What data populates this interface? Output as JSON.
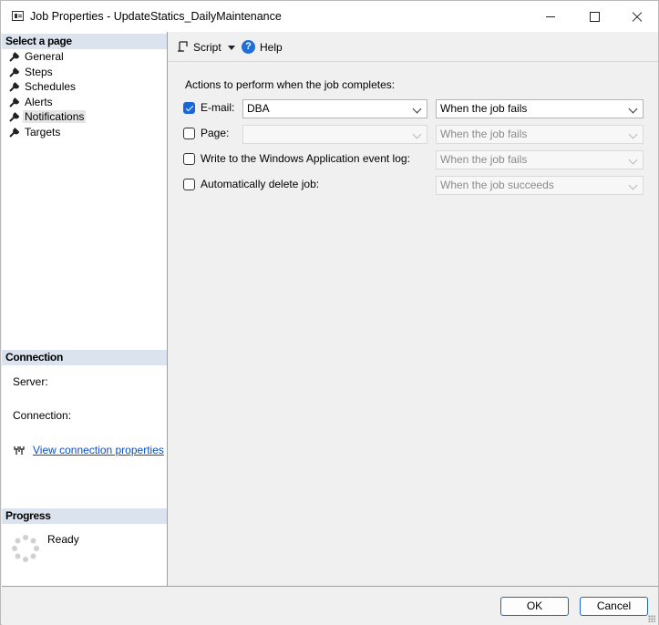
{
  "window": {
    "title": "Job Properties - UpdateStatics_DailyMaintenance"
  },
  "left_pane": {
    "select_page_header": "Select a page",
    "pages": [
      {
        "label": "General",
        "icon": "wrench-icon"
      },
      {
        "label": "Steps",
        "icon": "wrench-icon"
      },
      {
        "label": "Schedules",
        "icon": "wrench-icon"
      },
      {
        "label": "Alerts",
        "icon": "wrench-icon"
      },
      {
        "label": "Notifications",
        "icon": "wrench-icon",
        "selected": true
      },
      {
        "label": "Targets",
        "icon": "wrench-icon"
      }
    ],
    "connection_header": "Connection",
    "server_label": "Server:",
    "connection_label": "Connection:",
    "view_connection_link": "View connection properties",
    "progress_header": "Progress",
    "progress_status": "Ready"
  },
  "toolbar": {
    "script_label": "Script",
    "help_label": "Help",
    "help_glyph": "?"
  },
  "notifications": {
    "actions_label": "Actions to perform when the job completes:",
    "email": {
      "label": "E-mail:",
      "checked": true,
      "operator": "DBA",
      "condition": "When the job fails"
    },
    "page": {
      "label": "Page:",
      "checked": false,
      "operator": "",
      "condition": "When the job fails"
    },
    "eventlog": {
      "label": "Write to the Windows Application event log:",
      "checked": false,
      "condition": "When the job fails"
    },
    "delete": {
      "label": "Automatically delete job:",
      "checked": false,
      "condition": "When the job succeeds"
    }
  },
  "footer": {
    "ok_label": "OK",
    "cancel_label": "Cancel"
  },
  "colors": {
    "accent": "#1a66d6",
    "section_header": "#dbe4ee",
    "link": "#0a4dcc"
  }
}
